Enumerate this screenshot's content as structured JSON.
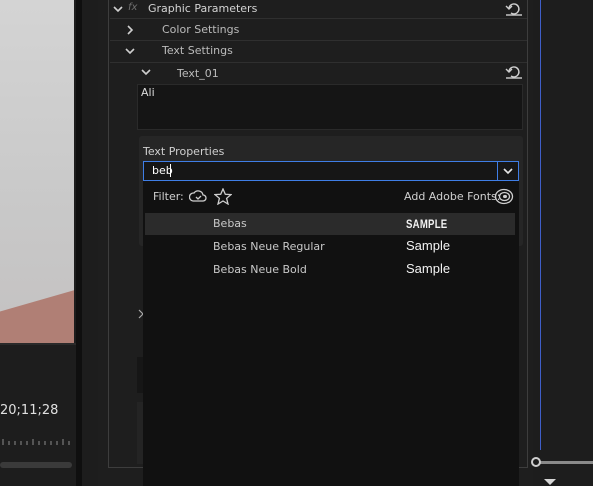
{
  "program_monitor": {
    "timecode": "20;11;28"
  },
  "effect_controls": {
    "section_title": "Graphic Parameters",
    "fx_badge": "fx",
    "items": [
      {
        "label": "Color Settings",
        "expanded": false
      },
      {
        "label": "Text Settings",
        "expanded": true
      }
    ],
    "text_layer": {
      "label": "Text_01",
      "value": "Ali"
    },
    "text_properties": {
      "label": "Text Properties",
      "font_search_value": "beb"
    }
  },
  "font_dropdown": {
    "filter_label": "Filter:",
    "add_fonts_label": "Add Adobe Fonts:",
    "fonts": [
      {
        "name": "Bebas",
        "sample": "SAMPLE",
        "selected": true
      },
      {
        "name": "Bebas Neue Regular",
        "sample": "Sample",
        "selected": false
      },
      {
        "name": "Bebas Neue Bold",
        "sample": "Sample",
        "selected": false
      }
    ]
  },
  "icons": {
    "reset": "reset-icon",
    "chevron": "chevron-icon",
    "cloud": "cloud-filter-icon",
    "star": "star-filter-icon",
    "creative_cloud": "creative-cloud-icon"
  },
  "colors": {
    "accent": "#3f7ee6",
    "panel_bg": "#1e1e1e",
    "dropdown_bg": "#111111"
  }
}
